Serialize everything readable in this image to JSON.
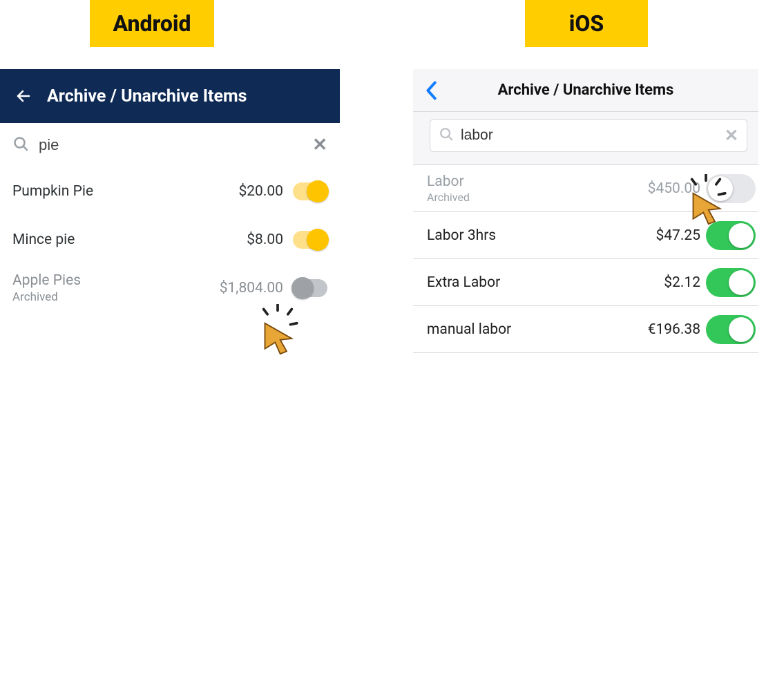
{
  "labels": {
    "android_badge": "Android",
    "ios_badge": "iOS"
  },
  "android": {
    "header_title": "Archive / Unarchive Items",
    "search_value": "pie",
    "items": [
      {
        "name": "Pumpkin Pie",
        "price": "$20.00",
        "archived": false,
        "toggle_on": true
      },
      {
        "name": "Mince pie",
        "price": "$8.00",
        "archived": false,
        "toggle_on": true
      },
      {
        "name": "Apple Pies",
        "price": "$1,804.00",
        "archived": true,
        "archived_label": "Archived",
        "toggle_on": false
      }
    ]
  },
  "ios": {
    "header_title": "Archive / Unarchive Items",
    "search_value": "labor",
    "items": [
      {
        "name": "Labor",
        "price": "$450.00",
        "archived": true,
        "archived_label": "Archived",
        "toggle_on": false
      },
      {
        "name": "Labor 3hrs",
        "price": "$47.25",
        "archived": false,
        "toggle_on": true
      },
      {
        "name": "Extra Labor",
        "price": "$2.12",
        "archived": false,
        "toggle_on": true
      },
      {
        "name": "manual labor",
        "price": "€196.38",
        "archived": false,
        "toggle_on": true
      }
    ]
  }
}
